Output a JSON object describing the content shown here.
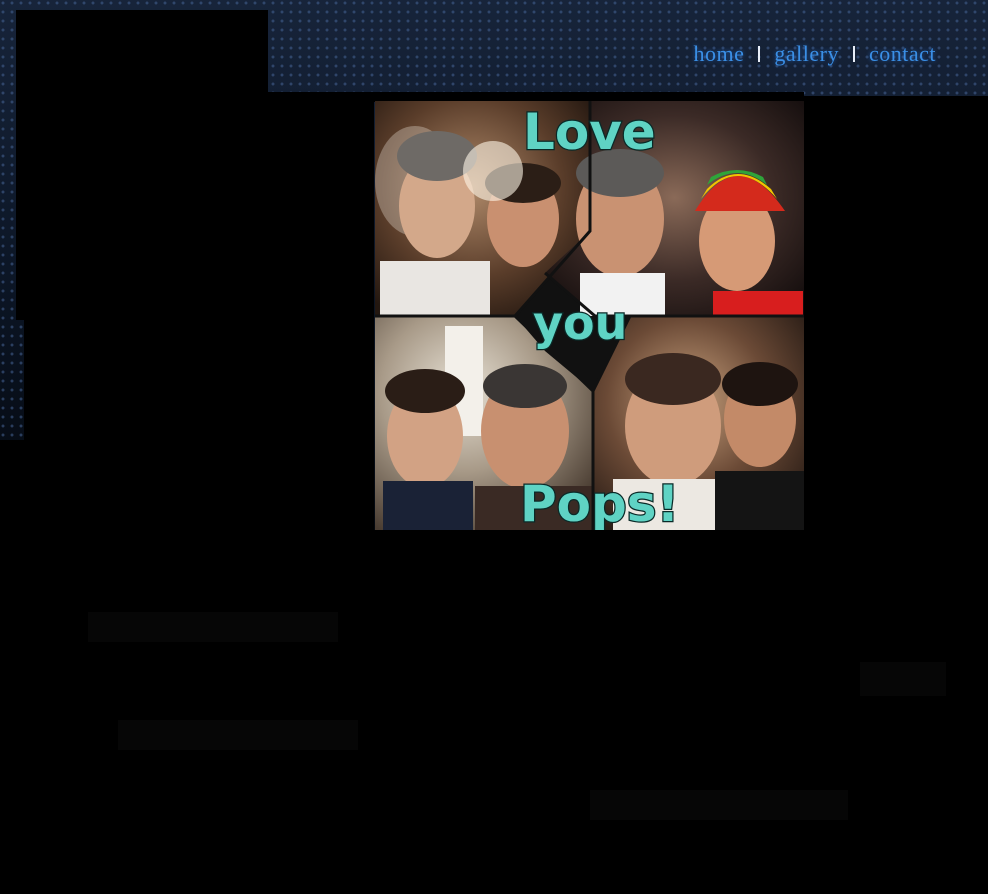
{
  "nav": {
    "items": [
      {
        "label": "home"
      },
      {
        "label": "gallery"
      },
      {
        "label": "contact"
      }
    ]
  },
  "collage": {
    "caption_words": [
      "Love",
      "you",
      "Pops!"
    ],
    "caption_color": "#5fd3c4"
  },
  "colors": {
    "nav_link": "#3a8fe6",
    "background_dots": "#46649a",
    "panel": "#000000"
  }
}
